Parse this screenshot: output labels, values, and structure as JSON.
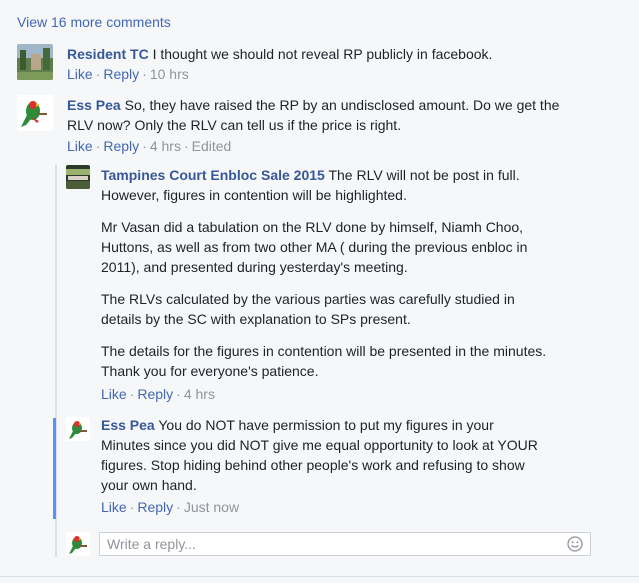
{
  "more_comments": "View 16 more comments",
  "comments": [
    {
      "author": "Resident TC",
      "text": "I thought we should not reveal RP publicly in facebook.",
      "like": "Like",
      "reply": "Reply",
      "time": "10 hrs"
    },
    {
      "author": "Ess Pea",
      "text_line1": "So, they have raised the RP by an undisclosed amount. Do we get the",
      "text_line2": "RLV now? Only the RLV can tell us if the price is right.",
      "like": "Like",
      "reply": "Reply",
      "time": "4 hrs",
      "edited": "Edited"
    }
  ],
  "replies": [
    {
      "author": "Tampines Court Enbloc Sale 2015",
      "p1_line1": "The RLV will not be post in full.",
      "p1_line2": "However, figures in contention will be highlighted.",
      "p2_line1": "Mr Vasan did a tabulation on the RLV done by himself, Niamh Choo,",
      "p2_line2": "Huttons, as well as from two other MA ( during the previous enbloc in",
      "p2_line3": "2011), and presented during yesterday's meeting.",
      "p3_line1": "The RLVs calculated by the various parties was carefully studied in",
      "p3_line2": "details by the SC with explanation to SPs present.",
      "p4_line1": "The details for the figures in contention will be presented in the minutes.",
      "p4_line2": "Thank you for everyone's patience.",
      "like": "Like",
      "reply": "Reply",
      "time": "4 hrs"
    },
    {
      "author": "Ess Pea",
      "text_line1": "You do NOT have permission to put my figures in your",
      "text_line2": "Minutes since you did NOT give me equal opportunity to look at YOUR",
      "text_line3": "figures. Stop hiding behind other people's work and refusing to show",
      "text_line4": "your own hand.",
      "like": "Like",
      "reply": "Reply",
      "time": "Just now"
    }
  ],
  "reply_input": {
    "placeholder": "Write a reply..."
  },
  "colors": {
    "link": "#4267b2",
    "name": "#365899",
    "meta": "#90949c",
    "highlight": "#5890ff",
    "text": "#1d2129"
  },
  "icons": [
    "smiley-icon"
  ]
}
